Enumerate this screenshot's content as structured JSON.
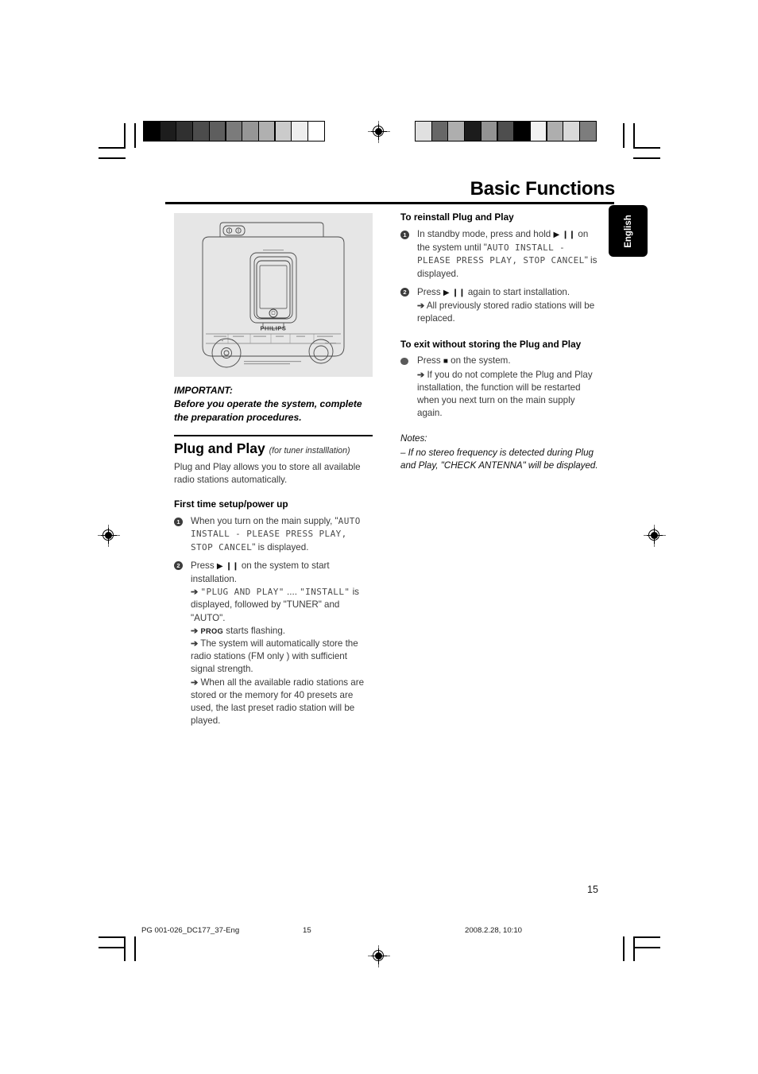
{
  "header": {
    "title": "Basic Functions",
    "language_tab": "English"
  },
  "left_column": {
    "figure_alt": "philips-dock-system-illustration",
    "figure_brand": "PHILIPS",
    "important_label": "IMPORTANT:",
    "important_text": "Before you operate the system, complete the preparation procedures.",
    "section_heading": "Plug and Play",
    "section_heading_sub": "(for tuner installlation)",
    "intro": "Plug and Play allows you to store all available radio stations automatically.",
    "subheading": "First time setup/power up",
    "steps": [
      {
        "num": "1",
        "text_before": "When you turn on the main supply,",
        "quote_open": "\"",
        "lcd": "AUTO INSTALL - PLEASE PRESS PLAY, STOP CANCEL",
        "quote_close": "\"",
        "text_after": "is displayed."
      },
      {
        "num": "2",
        "text_before": "Press",
        "glyph_play": "▶",
        "glyph_pause": "❙❙",
        "text_after": "on the system to start installation.",
        "arrows": [
          {
            "lcd_a": "\"PLUG AND PLAY\"",
            "ellipsis": "....",
            "lcd_b": "\"INSTALL\"",
            "tail": "is displayed, followed by \"TUNER\" and \"AUTO\"."
          },
          {
            "smallcaps": "PROG",
            "tail": "starts flashing."
          },
          {
            "tail": "The system will automatically store the radio stations (FM only ) with sufficient signal strength."
          },
          {
            "tail": "When all the available radio stations are stored or the memory for 40 presets are used, the last preset radio station will be played."
          }
        ]
      }
    ]
  },
  "right_column": {
    "heading_reinstall": "To reinstall Plug and Play",
    "reinstall_steps": [
      {
        "num": "1",
        "text_before": "In standby mode, press and hold",
        "glyph_play": "▶",
        "glyph_pause": "❙❙",
        "text_mid": "on the system until \"",
        "lcd": "AUTO INSTALL - PLEASE PRESS PLAY, STOP CANCEL",
        "text_after": "\" is displayed."
      },
      {
        "num": "2",
        "text_before": "Press",
        "glyph_play": "▶",
        "glyph_pause": "❙❙",
        "text_after": "again to start installation.",
        "arrow": "All previously stored radio stations will be replaced."
      }
    ],
    "heading_exit": "To exit without storing the Plug and Play",
    "exit_step": {
      "text_before": "Press",
      "glyph_stop": "■",
      "text_after": "on the system.",
      "arrow": "If you do not complete the Plug and Play installation, the function will be restarted when you next turn on the main supply again."
    },
    "notes_label": "Notes:",
    "notes": [
      "–  If no stereo frequency is detected during Plug and Play, \"CHECK ANTENNA\" will be displayed."
    ]
  },
  "page_number": "15",
  "footer": {
    "file": "PG 001-026_DC177_37-Eng",
    "page": "15",
    "date": "2008.2.28, 10:10"
  },
  "colorbars": {
    "left": [
      "#000000",
      "#1d1d1d",
      "#303030",
      "#4c4c4c",
      "#5e5e5e",
      "#7b7b7b",
      "#969696",
      "#b0b0b0",
      "#cbcbcb",
      "#eeeeee",
      "#ffffff"
    ],
    "right": [
      "#e0e0e0",
      "#676767",
      "#aeaeae",
      "#1c1c1c",
      "#939393",
      "#4e4e4e",
      "#000000",
      "#f2f2f2",
      "#aeaeae",
      "#d9d9d9",
      "#7d7d7d"
    ]
  },
  "colors": {
    "accent_black": "#000000",
    "body_gray": "#3a3a3a",
    "figure_bg": "#e6e6e6"
  }
}
